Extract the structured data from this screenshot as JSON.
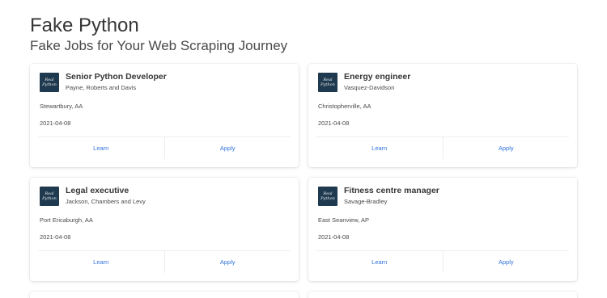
{
  "hero": {
    "title": "Fake Python",
    "subtitle": "Fake Jobs for Your Web Scraping Journey"
  },
  "logo": {
    "line1": "Real",
    "line2": "Python"
  },
  "jobs": [
    {
      "title": "Senior Python Developer",
      "company": "Payne, Roberts and Davis",
      "location": "Stewartbury, AA",
      "date": "2021-04-08",
      "learn_label": "Learn",
      "apply_label": "Apply"
    },
    {
      "title": "Energy engineer",
      "company": "Vasquez-Davidson",
      "location": "Christopherville, AA",
      "date": "2021-04-08",
      "learn_label": "Learn",
      "apply_label": "Apply"
    },
    {
      "title": "Legal executive",
      "company": "Jackson, Chambers and Levy",
      "location": "Port Ericaburgh, AA",
      "date": "2021-04-08",
      "learn_label": "Learn",
      "apply_label": "Apply"
    },
    {
      "title": "Fitness centre manager",
      "company": "Savage-Bradley",
      "location": "East Seanview, AP",
      "date": "2021-04-08",
      "learn_label": "Learn",
      "apply_label": "Apply"
    }
  ],
  "colors": {
    "link": "#3273dc",
    "logo_bg": "#1f3a4e",
    "title_text": "#363636"
  }
}
